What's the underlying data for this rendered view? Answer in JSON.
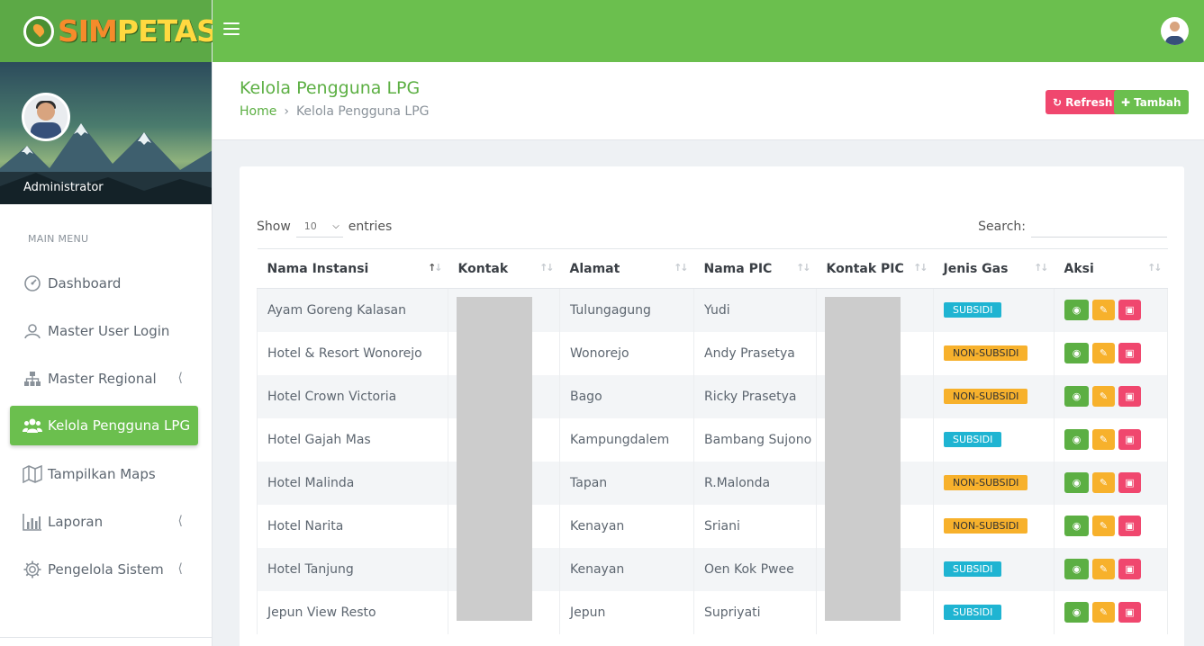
{
  "brand": {
    "part1": "SIM",
    "part2": "PETAS"
  },
  "profile": {
    "name": "Administrator"
  },
  "sidebar": {
    "menu_label": "MAIN MENU",
    "items": [
      {
        "label": "Dashboard",
        "icon": "dashboard-icon",
        "has_submenu": false
      },
      {
        "label": "Master User Login",
        "icon": "user-icon",
        "has_submenu": false
      },
      {
        "label": "Master Regional",
        "icon": "sitemap-icon",
        "has_submenu": true
      },
      {
        "label": "Kelola Pengguna LPG",
        "icon": "users-icon",
        "has_submenu": false,
        "active": true
      },
      {
        "label": "Tampilkan Maps",
        "icon": "map-icon",
        "has_submenu": false
      },
      {
        "label": "Laporan",
        "icon": "bar-chart-icon",
        "has_submenu": true
      },
      {
        "label": "Pengelola Sistem",
        "icon": "gear-icon",
        "has_submenu": true
      }
    ]
  },
  "header": {
    "title": "Kelola Pengguna LPG",
    "breadcrumb": [
      "Home",
      "Kelola Pengguna LPG"
    ],
    "refresh_label": "Refresh",
    "add_label": "Tambah"
  },
  "table": {
    "show_label": "Show",
    "entries_value": "10",
    "entries_label": "entries",
    "search_label": "Search:",
    "search_value": "",
    "columns": [
      "Nama Instansi",
      "Kontak",
      "Alamat",
      "Nama PIC",
      "Kontak PIC",
      "Jenis Gas",
      "Aksi"
    ],
    "sorted_column": "Nama Instansi",
    "rows": [
      {
        "nama": "Ayam Goreng Kalasan",
        "kontak": "",
        "alamat": "Tulungagung",
        "pic": "Yudi",
        "kontak_pic": "",
        "gas": "SUBSIDI"
      },
      {
        "nama": "Hotel & Resort Wonorejo",
        "kontak": "",
        "alamat": "Wonorejo",
        "pic": "Andy Prasetya",
        "kontak_pic": "",
        "gas": "NON-SUBSIDI"
      },
      {
        "nama": "Hotel Crown Victoria",
        "kontak": "",
        "alamat": "Bago",
        "pic": "Ricky Prasetya",
        "kontak_pic": "",
        "gas": "NON-SUBSIDI"
      },
      {
        "nama": "Hotel Gajah Mas",
        "kontak": "",
        "alamat": "Kampungdalem",
        "pic": "Bambang Sujono",
        "kontak_pic": "",
        "gas": "SUBSIDI"
      },
      {
        "nama": "Hotel Malinda",
        "kontak": "",
        "alamat": "Tapan",
        "pic": "R.Malonda",
        "kontak_pic": "",
        "gas": "NON-SUBSIDI"
      },
      {
        "nama": "Hotel Narita",
        "kontak": "",
        "alamat": "Kenayan",
        "pic": "Sriani",
        "kontak_pic": "",
        "gas": "NON-SUBSIDI"
      },
      {
        "nama": "Hotel Tanjung",
        "kontak": "",
        "alamat": "Kenayan",
        "pic": "Oen Kok Pwee",
        "kontak_pic": "",
        "gas": "SUBSIDI"
      },
      {
        "nama": "Jepun View Resto",
        "kontak": "",
        "alamat": "Jepun",
        "pic": "Supriyati",
        "kontak_pic": "",
        "gas": "SUBSIDI"
      }
    ]
  },
  "colors": {
    "primary": "#6bbf4e",
    "danger": "#f0476e",
    "warning": "#f7b12c",
    "info": "#1fb4d2"
  }
}
